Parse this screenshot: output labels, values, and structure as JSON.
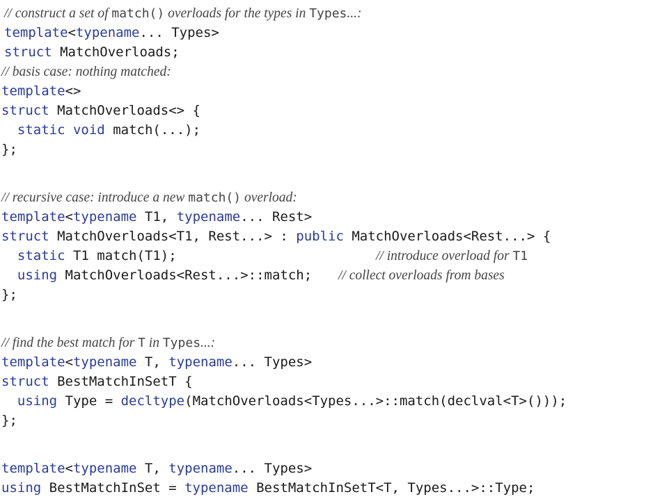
{
  "lines": [
    {
      "segments": [
        {
          "t": "// construct a set of ",
          "s": "cm"
        },
        {
          "t": "match()",
          "s": "cmcode"
        },
        {
          "t": " overloads for the types in ",
          "s": "cm"
        },
        {
          "t": "Types",
          "s": "cmcode"
        },
        {
          "t": "...:",
          "s": "cm"
        }
      ]
    },
    {
      "segments": [
        {
          "t": "template",
          "s": "kw"
        },
        {
          "t": "<",
          "s": "pl"
        },
        {
          "t": "typename",
          "s": "kw"
        },
        {
          "t": "... Types>",
          "s": "pl"
        }
      ]
    },
    {
      "segments": [
        {
          "t": "struct",
          "s": "kw"
        },
        {
          "t": " MatchOverloads;",
          "s": "pl"
        }
      ]
    },
    {
      "segments": [
        {
          "t": "// basis case: nothing matched:",
          "s": "cm"
        }
      ]
    },
    {
      "segments": [
        {
          "t": "template",
          "s": "kw"
        },
        {
          "t": "<>",
          "s": "pl"
        }
      ]
    },
    {
      "segments": [
        {
          "t": "struct",
          "s": "kw"
        },
        {
          "t": " MatchOverloads<> {",
          "s": "pl"
        }
      ]
    },
    {
      "segments": [
        {
          "t": "  ",
          "s": "pl"
        },
        {
          "t": "static",
          "s": "kw"
        },
        {
          "t": " ",
          "s": "pl"
        },
        {
          "t": "void",
          "s": "kw"
        },
        {
          "t": " match(...);",
          "s": "pl"
        }
      ]
    },
    {
      "segments": [
        {
          "t": "};",
          "s": "pl"
        }
      ]
    },
    {
      "segments": []
    },
    {
      "segments": [
        {
          "t": "// recursive case: introduce a new ",
          "s": "cm"
        },
        {
          "t": "match()",
          "s": "cmcode"
        },
        {
          "t": " overload:",
          "s": "cm"
        }
      ]
    },
    {
      "segments": [
        {
          "t": "template",
          "s": "kw"
        },
        {
          "t": "<",
          "s": "pl"
        },
        {
          "t": "typename",
          "s": "kw"
        },
        {
          "t": " T1, ",
          "s": "pl"
        },
        {
          "t": "typename",
          "s": "kw"
        },
        {
          "t": "... Rest>",
          "s": "pl"
        }
      ]
    },
    {
      "segments": [
        {
          "t": "struct",
          "s": "kw"
        },
        {
          "t": " MatchOverloads<T1, Rest...> : ",
          "s": "pl"
        },
        {
          "t": "public",
          "s": "kw"
        },
        {
          "t": " MatchOverloads<Rest...> {",
          "s": "pl"
        }
      ]
    },
    {
      "segments": [
        {
          "t": "  ",
          "s": "pl"
        },
        {
          "t": "static",
          "s": "kw"
        },
        {
          "t": " T1 match(T1);",
          "s": "pl"
        }
      ],
      "trail": [
        {
          "t": "// introduce overload for ",
          "s": "cm"
        },
        {
          "t": "T1",
          "s": "cmcode"
        }
      ]
    },
    {
      "segments": [
        {
          "t": "  ",
          "s": "pl"
        },
        {
          "t": "using",
          "s": "kw"
        },
        {
          "t": " MatchOverloads<Rest...>::match;",
          "s": "pl"
        }
      ],
      "trail": [
        {
          "t": "// collect overloads from bases",
          "s": "cm"
        }
      ]
    },
    {
      "segments": [
        {
          "t": "};",
          "s": "pl"
        }
      ]
    },
    {
      "segments": []
    },
    {
      "segments": [
        {
          "t": "// find the best match for ",
          "s": "cm"
        },
        {
          "t": "T",
          "s": "cmcode"
        },
        {
          "t": " in ",
          "s": "cm"
        },
        {
          "t": "Types",
          "s": "cmcode"
        },
        {
          "t": "...:",
          "s": "cm"
        }
      ]
    },
    {
      "segments": [
        {
          "t": "template",
          "s": "kw"
        },
        {
          "t": "<",
          "s": "pl"
        },
        {
          "t": "typename",
          "s": "kw"
        },
        {
          "t": " T, ",
          "s": "pl"
        },
        {
          "t": "typename",
          "s": "kw"
        },
        {
          "t": "... Types>",
          "s": "pl"
        }
      ]
    },
    {
      "segments": [
        {
          "t": "struct",
          "s": "kw"
        },
        {
          "t": " BestMatchInSetT {",
          "s": "pl"
        }
      ]
    },
    {
      "segments": [
        {
          "t": "  ",
          "s": "pl"
        },
        {
          "t": "using",
          "s": "kw"
        },
        {
          "t": " Type = ",
          "s": "pl"
        },
        {
          "t": "decltype",
          "s": "kw"
        },
        {
          "t": "(MatchOverloads<Types...>::match(declval<T>()));",
          "s": "pl"
        }
      ]
    },
    {
      "segments": [
        {
          "t": "};",
          "s": "pl"
        }
      ]
    },
    {
      "segments": []
    },
    {
      "segments": [
        {
          "t": "template",
          "s": "kw"
        },
        {
          "t": "<",
          "s": "pl"
        },
        {
          "t": "typename",
          "s": "kw"
        },
        {
          "t": " T, ",
          "s": "pl"
        },
        {
          "t": "typename",
          "s": "kw"
        },
        {
          "t": "... Types>",
          "s": "pl"
        }
      ]
    },
    {
      "segments": [
        {
          "t": "using",
          "s": "kw"
        },
        {
          "t": " BestMatchInSet = ",
          "s": "pl"
        },
        {
          "t": "typename",
          "s": "kw"
        },
        {
          "t": " BestMatchInSetT<T, Types...>::Type;",
          "s": "pl"
        }
      ]
    }
  ]
}
